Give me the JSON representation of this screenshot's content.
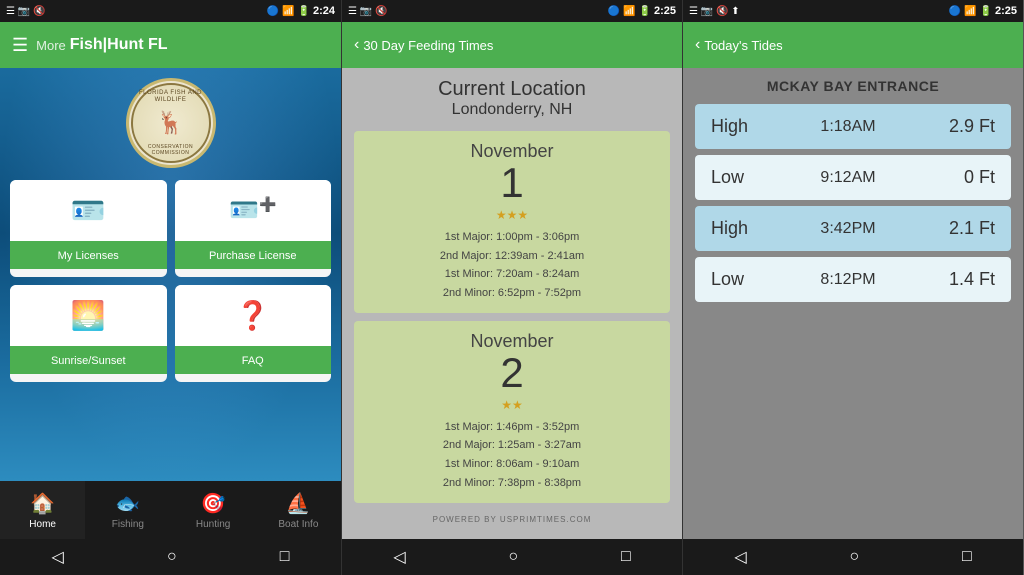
{
  "phones": [
    {
      "id": "phone1",
      "statusBar": {
        "time": "2:24",
        "leftIcons": [
          "☰",
          "📷",
          "🔇",
          "📶"
        ],
        "rightIcons": [
          "🔵",
          "📶",
          "🔋"
        ]
      },
      "header": {
        "menuIcon": "☰",
        "moreLabel": "More",
        "appTitle": "Fish|Hunt FL"
      },
      "logo": {
        "topText": "FLORIDA FISH AND WILDLIFE",
        "bottomText": "CONSERVATION COMMISSION",
        "deerEmoji": "🦌"
      },
      "menuItems": [
        {
          "id": "my-licenses",
          "icon": "🪪",
          "label": "My Licenses"
        },
        {
          "id": "purchase-license",
          "icon": "🪪➕",
          "label": "Purchase License"
        },
        {
          "id": "sunrise-sunset",
          "icon": "🌅",
          "label": "Sunrise/Sunset"
        },
        {
          "id": "faq",
          "icon": "❓",
          "label": "FAQ"
        }
      ],
      "bottomNav": [
        {
          "id": "home",
          "icon": "🏠",
          "label": "Home",
          "active": true
        },
        {
          "id": "fishing",
          "icon": "🐟",
          "label": "Fishing",
          "active": false
        },
        {
          "id": "hunting",
          "icon": "🎯",
          "label": "Hunting",
          "active": false
        },
        {
          "id": "boat-info",
          "icon": "⛵",
          "label": "Boat Info",
          "active": false
        }
      ],
      "navBar": [
        "◁",
        "○",
        "□"
      ]
    },
    {
      "id": "phone2",
      "statusBar": {
        "time": "2:25",
        "leftIcons": [
          "☰",
          "📷",
          "🔇",
          "📶"
        ],
        "rightIcons": [
          "🔵",
          "📶",
          "🔋"
        ]
      },
      "header": {
        "backLabel": "30 Day Feeding Times"
      },
      "location": {
        "name": "Current Location",
        "city": "Londonderry, NH"
      },
      "days": [
        {
          "month": "November",
          "day": "1",
          "stars": "★★★",
          "times": [
            "1st Major: 1:00pm - 3:06pm",
            "2nd Major: 12:39am - 2:41am",
            "1st Minor: 7:20am - 8:24am",
            "2nd Minor: 6:52pm - 7:52pm"
          ]
        },
        {
          "month": "November",
          "day": "2",
          "stars": "★★",
          "times": [
            "1st Major: 1:46pm - 3:52pm",
            "2nd Major: 1:25am - 3:27am",
            "1st Minor: 8:06am - 9:10am",
            "2nd Minor: 7:38pm - 8:38pm"
          ]
        }
      ],
      "poweredBy": "POWERED BY USPRIMTIMES.COM",
      "navBar": [
        "◁",
        "○",
        "□"
      ]
    },
    {
      "id": "phone3",
      "statusBar": {
        "time": "2:25",
        "leftIcons": [
          "☰",
          "📷",
          "🔇",
          "📶"
        ],
        "rightIcons": [
          "🔵",
          "📶",
          "🔋"
        ]
      },
      "header": {
        "backLabel": "Today's Tides"
      },
      "tidesLocation": "MCKAY BAY ENTRANCE",
      "tides": [
        {
          "type": "High",
          "time": "1:18AM",
          "height": "2.9 Ft",
          "style": "blue"
        },
        {
          "type": "Low",
          "time": "9:12AM",
          "height": "0 Ft",
          "style": "white"
        },
        {
          "type": "High",
          "time": "3:42PM",
          "height": "2.1 Ft",
          "style": "blue"
        },
        {
          "type": "Low",
          "time": "8:12PM",
          "height": "1.4 Ft",
          "style": "white"
        }
      ],
      "navBar": [
        "◁",
        "○",
        "□"
      ]
    }
  ]
}
